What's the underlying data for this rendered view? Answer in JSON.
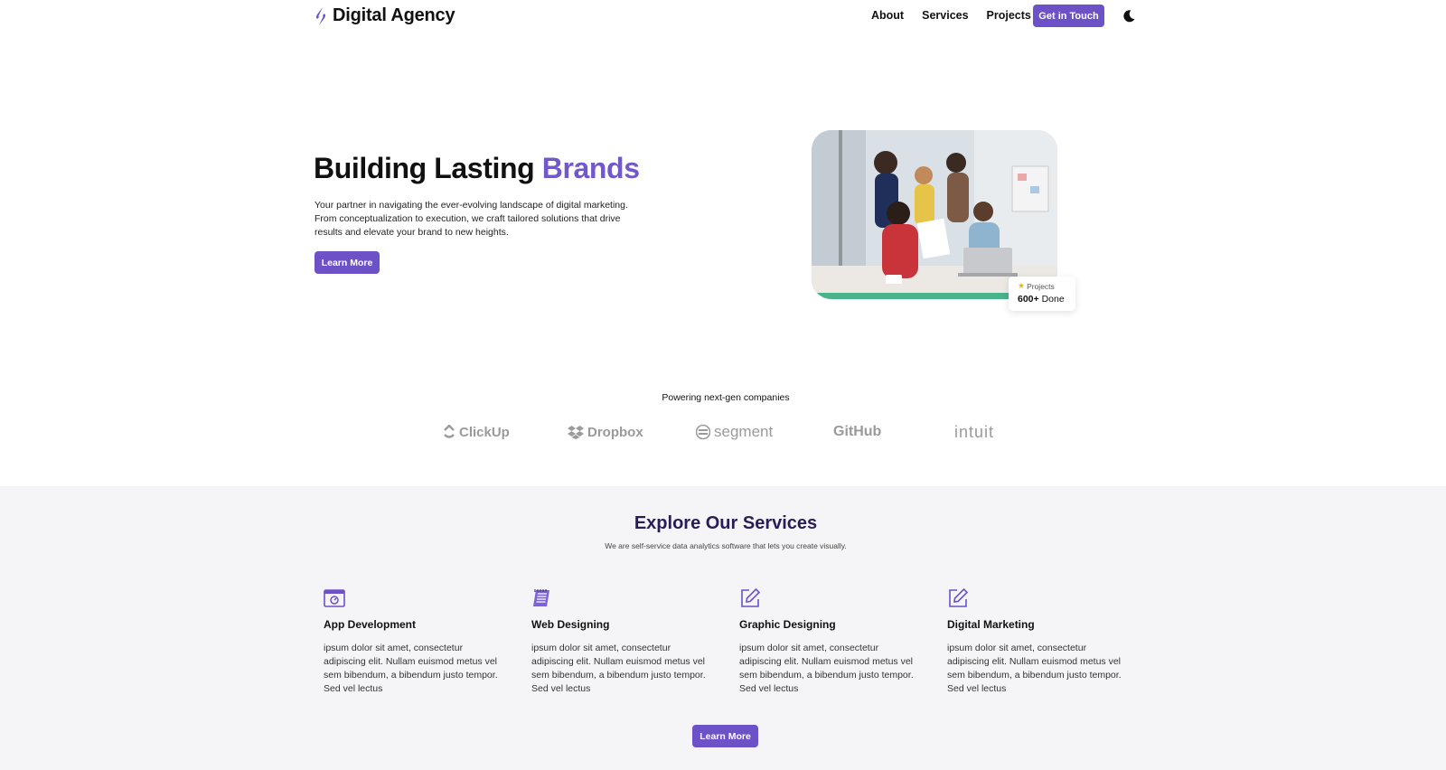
{
  "nav": {
    "brand": "Digital Agency",
    "links": [
      "About",
      "Services",
      "Projects"
    ],
    "cta": "Get in Touch",
    "theme_icon": "moon-icon"
  },
  "hero": {
    "title_main": "Building Lasting ",
    "title_accent": "Brands",
    "description": "Your partner in navigating the ever-evolving landscape of digital marketing. From conceptualization to execution, we craft tailored solutions that drive results and elevate your brand to new heights.",
    "button": "Learn More",
    "stat": {
      "label": "Projects",
      "value": "600+",
      "suffix": "Done"
    }
  },
  "logos": {
    "title": "Powering next-gen companies",
    "items": [
      "ClickUp",
      "Dropbox",
      "segment",
      "GitHub",
      "intuit"
    ]
  },
  "services": {
    "title": "Explore Our Services",
    "subtitle": "We are self-service data analytics software that lets you create visually.",
    "items": [
      {
        "name": "App Development",
        "icon": "app-window-icon",
        "description": "ipsum dolor sit amet, consectetur adipiscing elit. Nullam euismod metus vel sem bibendum, a bibendum justo tempor. Sed vel lectus"
      },
      {
        "name": "Web Designing",
        "icon": "notebook-icon",
        "description": "ipsum dolor sit amet, consectetur adipiscing elit. Nullam euismod metus vel sem bibendum, a bibendum justo tempor. Sed vel lectus"
      },
      {
        "name": "Graphic Designing",
        "icon": "edit-icon",
        "description": "ipsum dolor sit amet, consectetur adipiscing elit. Nullam euismod metus vel sem bibendum, a bibendum justo tempor. Sed vel lectus"
      },
      {
        "name": "Digital Marketing",
        "icon": "edit-icon",
        "description": "ipsum dolor sit amet, consectetur adipiscing elit. Nullam euismod metus vel sem bibendum, a bibendum justo tempor. Sed vel lectus"
      }
    ],
    "button": "Learn More"
  },
  "colors": {
    "accent": "#6d51c7",
    "accent_text": "#7358cc",
    "services_title": "#2a1c55",
    "services_bg": "#f5f5f7"
  }
}
